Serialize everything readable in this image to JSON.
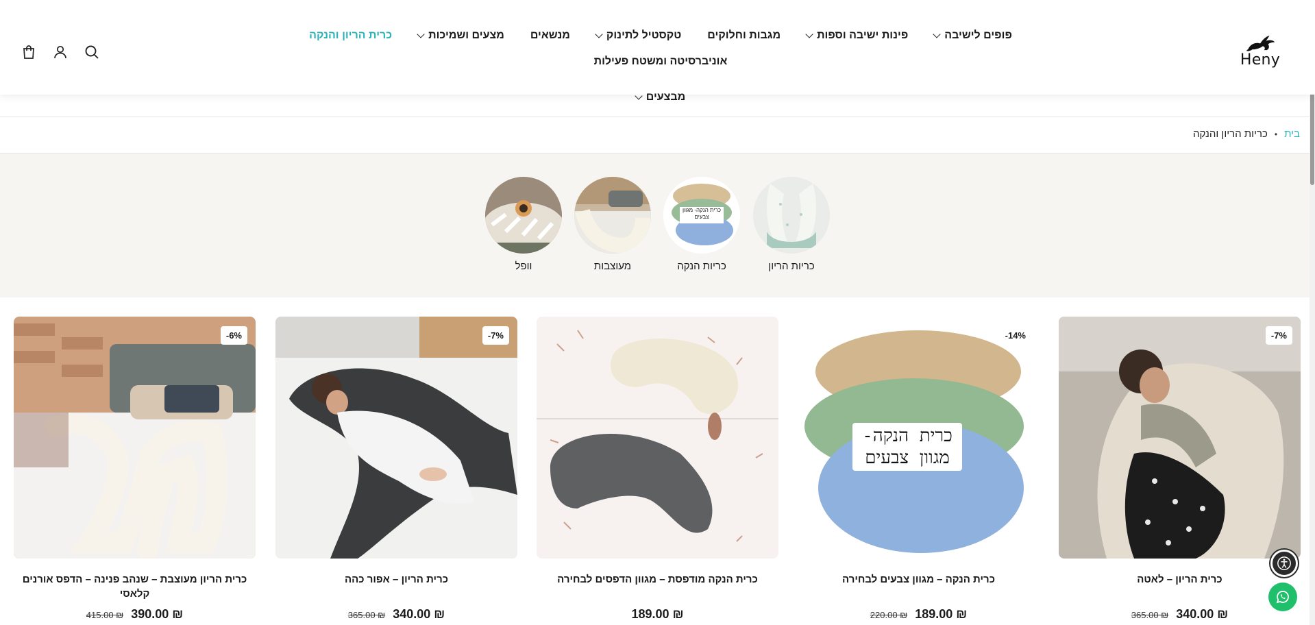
{
  "brand": {
    "logo_text": "Heny"
  },
  "nav": {
    "row1": [
      {
        "label": "פופים לישיבה",
        "dropdown": true
      },
      {
        "label": "פינות ישיבה וספות",
        "dropdown": true
      },
      {
        "label": "מגבות וחלוקים",
        "dropdown": false
      },
      {
        "label": "טקסטיל לתינוק",
        "dropdown": true
      },
      {
        "label": "מנשאים",
        "dropdown": false
      },
      {
        "label": "מצעים ושמיכות",
        "dropdown": true
      },
      {
        "label": "כרית הריון והנקה",
        "dropdown": false,
        "active": true
      },
      {
        "label": "אוניברסיטה ומשטח פעילות",
        "dropdown": false
      }
    ],
    "row2": [
      {
        "label": "מבצעים",
        "dropdown": true
      }
    ]
  },
  "header_icons": [
    "search-icon",
    "user-icon",
    "cart-icon"
  ],
  "breadcrumb": {
    "home": "בית",
    "separator": "•",
    "current": "כריות הריון והנקה"
  },
  "categories": [
    {
      "label": "כריות הריון"
    },
    {
      "label": "כריות הנקה",
      "overlay": "כרית הנקה- מגוון צבעים"
    },
    {
      "label": "מעוצבות"
    },
    {
      "label": "וופל"
    }
  ],
  "products": [
    {
      "title": "כרית הריון – לאטה",
      "badge": "-7%",
      "price": "₪ 340.00",
      "old_price": "₪ 365.00"
    },
    {
      "title": "כרית הנקה – מגוון צבעים לבחירה",
      "badge": "-14%",
      "price": "₪ 189.00",
      "old_price": "₪ 220.00",
      "overlay": "כרית הנקה- מגוון צבעים"
    },
    {
      "title": "כרית הנקה מודפסת – מגוון הדפסים לבחירה",
      "badge": "",
      "price": "₪ 189.00",
      "old_price": ""
    },
    {
      "title": "כרית הריון – אפור כהה",
      "badge": "-7%",
      "price": "₪ 340.00",
      "old_price": "₪ 365.00"
    },
    {
      "title": "כרית הריון מעוצבת – שנהב פנינה – הדפס אורנים קלאסי",
      "badge": "-6%",
      "price": "₪ 390.00",
      "old_price": "₪ 415.00"
    }
  ],
  "colors": {
    "accent": "#2ab3b7",
    "whatsapp": "#1fbf6b",
    "strip_bg": "#f6f5f2"
  }
}
